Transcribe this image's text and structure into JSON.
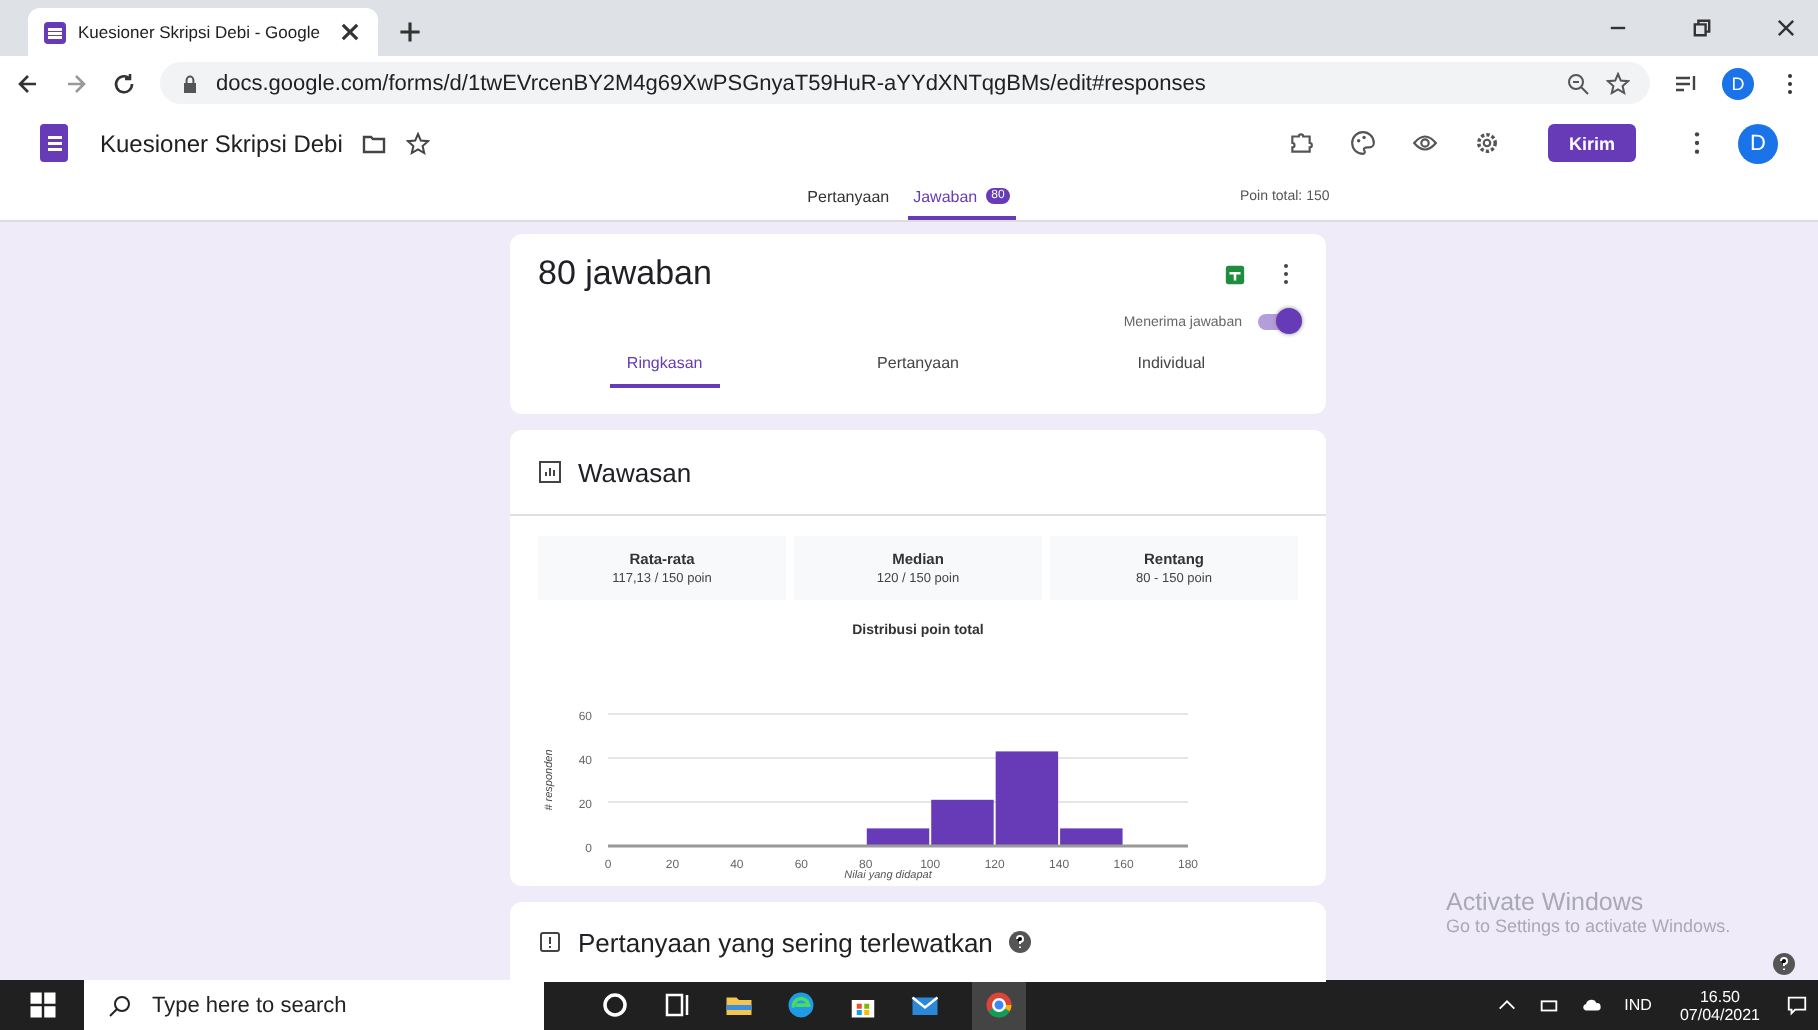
{
  "browser": {
    "tab_title": "Kuesioner Skripsi Debi - Google",
    "url": "docs.google.com/forms/d/1twEVrcenBY2M4g69XwPSGnyaT59HuR-aYYdXNTqgBMs/edit#responses",
    "profile": "D"
  },
  "header": {
    "title": "Kuesioner Skripsi Debi",
    "send_button": "Kirim",
    "avatar": "D"
  },
  "nav_tabs": [
    {
      "label": "Pertanyaan",
      "selected": false
    },
    {
      "label": "Jawaban",
      "selected": true,
      "badge": "80"
    }
  ],
  "points_total": "Poin total: 150",
  "responses": {
    "title": "80 jawaban",
    "accepting_label": "Menerima jawaban",
    "accepting": true,
    "tabs": [
      {
        "label": "Ringkasan",
        "selected": true
      },
      {
        "label": "Pertanyaan",
        "selected": false
      },
      {
        "label": "Individual",
        "selected": false
      }
    ]
  },
  "insights": {
    "title": "Wawasan",
    "stats": [
      {
        "label": "Rata-rata",
        "value": "117,13 / 150 poin"
      },
      {
        "label": "Median",
        "value": "120 / 150 poin"
      },
      {
        "label": "Rentang",
        "value": "80 - 150 poin"
      }
    ],
    "chart_data": {
      "type": "bar",
      "title": "Distribusi poin total",
      "xlabel": "Nilai yang didapat",
      "ylabel": "# responden",
      "x": [
        90,
        110,
        130,
        150
      ],
      "values": [
        8,
        21,
        43,
        8
      ],
      "xlim": [
        0,
        180
      ],
      "ylim": [
        0,
        60
      ],
      "xticks": [
        0,
        20,
        40,
        60,
        80,
        100,
        120,
        140,
        160,
        180
      ],
      "yticks": [
        0,
        20,
        40,
        60
      ]
    }
  },
  "missed": {
    "title": "Pertanyaan yang sering terlewatkan"
  },
  "activation": {
    "title": "Activate Windows",
    "subtitle": "Go to Settings to activate Windows."
  },
  "taskbar": {
    "search_placeholder": "Type here to search",
    "language": "IND",
    "time": "16.50",
    "date": "07/04/2021"
  }
}
